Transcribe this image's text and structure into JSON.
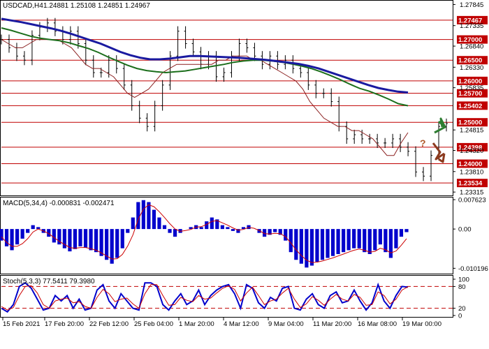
{
  "header": {
    "symbol": "USDCAD,H4",
    "ohlc": "1.24881 1.25108 1.24851 1.24967"
  },
  "chart_data": {
    "type": "line",
    "symbol": "USDCAD",
    "timeframe": "H4",
    "last": {
      "open": 1.24881,
      "high": 1.25108,
      "low": 1.24851,
      "close": 1.24967
    },
    "price_axis": {
      "ylim": [
        1.2325,
        1.2792
      ],
      "ticks": [
        "1.27845",
        "1.27335",
        "1.26840",
        "1.26330",
        "1.25835",
        "1.24815",
        "1.24320",
        "1.23810",
        "1.23315"
      ],
      "labeled_levels": [
        {
          "value": 1.27467,
          "label": "1.27467"
        },
        {
          "value": 1.27,
          "label": "1.27000"
        },
        {
          "value": 1.265,
          "label": "1.26500"
        },
        {
          "value": 1.26,
          "label": "1.26000"
        },
        {
          "value": 1.257,
          "label": "1.25700"
        },
        {
          "value": 1.25402,
          "label": "1.25402"
        },
        {
          "value": 1.25,
          "label": "1.25000"
        },
        {
          "value": 1.24398,
          "label": "1.24398"
        },
        {
          "value": 1.24,
          "label": "1.24000"
        },
        {
          "value": 1.23534,
          "label": "1.23534"
        }
      ]
    },
    "x_labels": [
      "15 Feb 2021",
      "17 Feb 20:00",
      "22 Feb 12:00",
      "25 Feb 04:00",
      "1 Mar 20:00",
      "4 Mar 12:00",
      "9 Mar 04:00",
      "11 Mar 20:00",
      "16 Mar 08:00",
      "19 Mar 00:00"
    ],
    "price_close": [
      1.27,
      1.268,
      1.266,
      1.265,
      1.271,
      1.273,
      1.274,
      1.272,
      1.27,
      1.272,
      1.269,
      1.265,
      1.262,
      1.262,
      1.265,
      1.263,
      1.259,
      1.254,
      1.251,
      1.249,
      1.254,
      1.259,
      1.266,
      1.272,
      1.269,
      1.267,
      1.264,
      1.266,
      1.261,
      1.262,
      1.266,
      1.269,
      1.268,
      1.266,
      1.264,
      1.266,
      1.264,
      1.265,
      1.263,
      1.262,
      1.259,
      1.257,
      1.257,
      1.255,
      1.249,
      1.246,
      1.247,
      1.246,
      1.246,
      1.245,
      1.245,
      1.246,
      1.244,
      1.243,
      1.238,
      1.237,
      1.242,
      1.249,
      1.2497
    ],
    "ma_fast": [
      1.27,
      1.269,
      1.268,
      1.268,
      1.269,
      1.27,
      1.27,
      1.27,
      1.27,
      1.269,
      1.268,
      1.266,
      1.264,
      1.263,
      1.263,
      1.262,
      1.261,
      1.259,
      1.257,
      1.256,
      1.257,
      1.258,
      1.26,
      1.262,
      1.263,
      1.264,
      1.264,
      1.264,
      1.264,
      1.264,
      1.264,
      1.265,
      1.265,
      1.266,
      1.266,
      1.266,
      1.265,
      1.265,
      1.264,
      1.263,
      1.262,
      1.261,
      1.26,
      1.258,
      1.255,
      1.253,
      1.251,
      1.25,
      1.249,
      1.249,
      1.248,
      1.248,
      1.247,
      1.246,
      1.244,
      1.242,
      1.242,
      1.245,
      1.2475
    ],
    "ma_mid": [
      1.2728,
      1.2722,
      1.2715,
      1.2708,
      1.2703,
      1.27,
      1.2697,
      1.2692,
      1.2685,
      1.2678,
      1.2669,
      1.2658,
      1.2648,
      1.2638,
      1.263,
      1.2625,
      1.2622,
      1.262,
      1.2622,
      1.2624,
      1.2628,
      1.2632,
      1.2636,
      1.264,
      1.2645,
      1.2648,
      1.265,
      1.265,
      1.2648,
      1.2645,
      1.2641,
      1.2636,
      1.263,
      1.2622,
      1.2613,
      1.2603,
      1.2592,
      1.2582,
      1.2575,
      1.2566,
      1.2556,
      1.2545,
      1.254
    ],
    "ma_slow": [
      1.275,
      1.2746,
      1.2742,
      1.2737,
      1.2732,
      1.2727,
      1.2721,
      1.2714,
      1.2706,
      1.2698,
      1.269,
      1.268,
      1.267,
      1.2662,
      1.2656,
      1.2652,
      1.2652,
      1.2654,
      1.2657,
      1.266,
      1.266,
      1.2659,
      1.2658,
      1.2657,
      1.2656,
      1.2654,
      1.2652,
      1.265,
      1.2647,
      1.2644,
      1.2641,
      1.2636,
      1.263,
      1.2622,
      1.2614,
      1.2606,
      1.2598,
      1.259,
      1.2583,
      1.2578,
      1.2574,
      1.2572
    ],
    "macd": {
      "title": "MACD(5,34,4) -0.000831 -0.002471",
      "ylim": [
        -0.0114,
        0.008
      ],
      "ticks": [
        "0.007623",
        "0.00",
        "-0.010196"
      ],
      "histogram": [
        -0.003,
        -0.0045,
        -0.0055,
        -0.004,
        -0.0025,
        -0.001,
        0.001,
        0.0005,
        -0.001,
        -0.002,
        -0.0035,
        -0.004,
        -0.005,
        -0.0058,
        -0.0052,
        -0.0045,
        -0.0048,
        -0.0055,
        -0.006,
        -0.007,
        -0.008,
        -0.009,
        -0.0075,
        -0.005,
        -0.001,
        0.003,
        0.007,
        0.0075,
        0.007,
        0.005,
        0.003,
        0.001,
        -0.001,
        -0.002,
        -0.001,
        0.0,
        0.0005,
        0.001,
        0.0005,
        0.002,
        0.003,
        0.0025,
        0.001,
        0.0005,
        -0.0005,
        -0.001,
        0.0005,
        0.001,
        0.0,
        -0.001,
        -0.002,
        -0.0015,
        -0.0008,
        -0.0015,
        -0.003,
        -0.006,
        -0.008,
        -0.009,
        -0.01,
        -0.0095,
        -0.0085,
        -0.008,
        -0.0075,
        -0.007,
        -0.0065,
        -0.006,
        -0.0055,
        -0.005,
        -0.005,
        -0.006,
        -0.0065,
        -0.0055,
        -0.004,
        -0.006,
        -0.0075,
        -0.005,
        -0.002,
        -0.0008
      ],
      "signal": [
        -0.002,
        -0.0035,
        -0.0045,
        -0.0045,
        -0.0038,
        -0.0025,
        -0.0008,
        0.0,
        -0.0005,
        -0.0012,
        -0.0022,
        -0.0032,
        -0.004,
        -0.0048,
        -0.005,
        -0.0048,
        -0.0048,
        -0.0051,
        -0.0055,
        -0.0062,
        -0.007,
        -0.0078,
        -0.0077,
        -0.0066,
        -0.0044,
        -0.0015,
        0.0025,
        0.0052,
        0.0063,
        0.0058,
        0.0045,
        0.003,
        0.0014,
        0.0,
        -0.0006,
        -0.0004,
        -0.0001,
        0.0005,
        0.0006,
        0.0012,
        0.002,
        0.0022,
        0.0016,
        0.001,
        0.0003,
        -0.0003,
        -0.0001,
        0.0004,
        0.0002,
        -0.0004,
        -0.0012,
        -0.0013,
        -0.0011,
        -0.0012,
        -0.002,
        -0.0036,
        -0.0054,
        -0.0069,
        -0.0081,
        -0.0087,
        -0.0086,
        -0.0083,
        -0.0079,
        -0.0075,
        -0.007,
        -0.0065,
        -0.006,
        -0.0055,
        -0.0052,
        -0.0055,
        -0.006,
        -0.0058,
        -0.005,
        -0.0054,
        -0.0062,
        -0.0057,
        -0.0042,
        -0.0025
      ]
    },
    "stochastic": {
      "title": "Stoch(5,3,3) 77.5411 79.3980",
      "ylim": [
        0,
        100
      ],
      "ticks": [
        "100",
        "80",
        "20",
        "0"
      ],
      "levels": [
        80,
        20
      ],
      "main": [
        20,
        10,
        30,
        80,
        90,
        75,
        45,
        15,
        20,
        55,
        40,
        55,
        20,
        45,
        15,
        20,
        70,
        85,
        40,
        20,
        60,
        40,
        20,
        15,
        90,
        90,
        80,
        30,
        15,
        40,
        60,
        30,
        40,
        70,
        30,
        55,
        70,
        80,
        85,
        60,
        20,
        85,
        75,
        35,
        20,
        50,
        40,
        75,
        80,
        20,
        15,
        45,
        60,
        30,
        20,
        55,
        65,
        35,
        40,
        70,
        40,
        15,
        35,
        85,
        40,
        20,
        55,
        80,
        78
      ],
      "signal": [
        25,
        15,
        22,
        55,
        80,
        82,
        62,
        30,
        20,
        40,
        45,
        48,
        35,
        38,
        25,
        20,
        50,
        72,
        60,
        38,
        45,
        48,
        32,
        20,
        60,
        85,
        85,
        55,
        28,
        30,
        50,
        42,
        38,
        55,
        45,
        48,
        62,
        75,
        82,
        72,
        40,
        62,
        78,
        55,
        30,
        40,
        45,
        62,
        75,
        45,
        22,
        32,
        52,
        42,
        28,
        45,
        58,
        45,
        40,
        58,
        50,
        28,
        30,
        65,
        55,
        32,
        45,
        70,
        79
      ]
    },
    "annotations": {
      "question": "?",
      "up_arrow_color": "#2e7d32",
      "down_arrow_color": "#8b3a1e"
    },
    "colors": {
      "price": "#000000",
      "ma_fast": "#8b2020",
      "ma_mid": "#1b6e1b",
      "ma_slow": "#1a1aa0",
      "level": "#c00000",
      "macd_hist": "#0000cc",
      "signal": "#cc0000",
      "stoch": "#0000cc"
    }
  }
}
